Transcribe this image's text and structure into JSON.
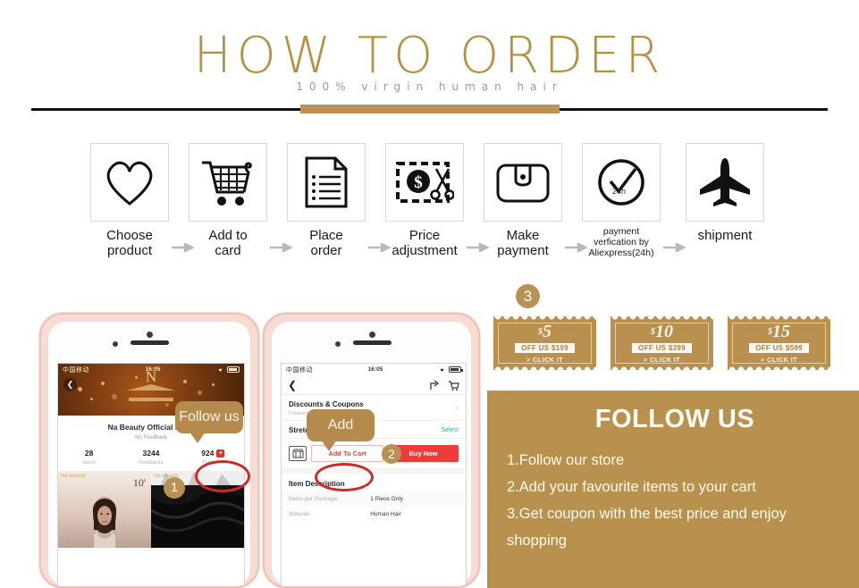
{
  "header": {
    "title": "HOW TO ORDER",
    "subtitle": "100% virgin human hair"
  },
  "steps": [
    {
      "icon": "heart-icon",
      "label_line1": "Choose",
      "label_line2": "product"
    },
    {
      "icon": "shopping-cart-icon",
      "label_line1": "Add to",
      "label_line2": "card"
    },
    {
      "icon": "document-icon",
      "label_line1": "Place",
      "label_line2": "order"
    },
    {
      "icon": "price-cut-icon",
      "label_line1": "Price",
      "label_line2": "adjustment"
    },
    {
      "icon": "wallet-icon",
      "label_line1": "Make",
      "label_line2": "payment"
    },
    {
      "icon": "clock-check-icon",
      "label_line1": "payment",
      "label_line2": "verfication by",
      "label_line3": "Aliexpress(24h)",
      "icon_text": "24h"
    },
    {
      "icon": "airplane-icon",
      "label_line1": "shipment",
      "label_line2": ""
    }
  ],
  "phone_left": {
    "status": {
      "carrier": "中国移动",
      "time": "16:05"
    },
    "back_icon": "back-chevron-icon",
    "logo_letter": "N",
    "logo_sub": "Na Beauty",
    "store_name": "Na Beauty Official Store",
    "feedback": "No Feedback",
    "stats": [
      {
        "value": "28",
        "label": "Items"
      },
      {
        "value": "3244",
        "label": "Feedbacks"
      },
      {
        "value": "924",
        "label": "Followers",
        "badge": "+"
      }
    ],
    "product_label": "10'",
    "watermark": "Na Beauty",
    "callout": "Follow us",
    "badge": "1"
  },
  "phone_right": {
    "status": {
      "carrier": "中国移动",
      "time": "16:05"
    },
    "back_icon": "back-chevron-icon",
    "share_icon": "share-icon",
    "cart_icon": "cart-icon",
    "discounts_title": "Discounts & Coupons",
    "discounts_sub": "Coupons",
    "length_title": "Stretched Length",
    "select_label": "Select",
    "store_icon": "store-icon",
    "add_to_cart": "Add To Cart",
    "buy_now": "Buy Now",
    "description_title": "Item Description",
    "description_rows": [
      {
        "key": "Items per Package",
        "value": "1 Piece Only"
      },
      {
        "key": "Material",
        "value": "Human Hair"
      }
    ],
    "callout": "Add",
    "badge": "2"
  },
  "right_panel": {
    "badge": "3",
    "coupons": [
      {
        "currency": "$",
        "amount": "5",
        "off": "OFF US $199",
        "cta": "> CLICK IT"
      },
      {
        "currency": "$",
        "amount": "10",
        "off": "OFF US $399",
        "cta": "> CLICK IT"
      },
      {
        "currency": "$",
        "amount": "15",
        "off": "OFF US $599",
        "cta": "> CLICK IT"
      }
    ],
    "follow_title": "FOLLOW US",
    "follow_lines": [
      "1.Follow our store",
      "2.Add your favourite items to your cart",
      "3.Get coupon with the best price and enjoy",
      "shopping"
    ]
  },
  "colors": {
    "gold": "#b9914f",
    "gold_dark": "#b6913f",
    "red": "#ee3b3b",
    "highlight_red": "#cf2a2a",
    "black_rule": "#111111"
  }
}
